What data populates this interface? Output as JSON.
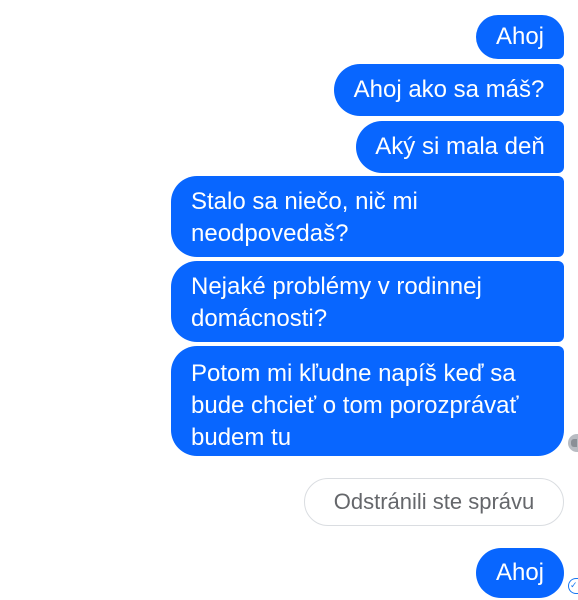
{
  "messages": [
    {
      "text": "Ahoj"
    },
    {
      "text": "Ahoj ako sa máš?"
    },
    {
      "text": "Aký si mala deň"
    },
    {
      "text": "Stalo sa niečo, nič mi neodpovedaš?"
    },
    {
      "text": "Nejaké problémy v rodinnej domácnosti?"
    },
    {
      "text": "Potom mi kľudne napíš keď sa bude chcieť o tom porozprávať budem tu"
    },
    {
      "text": "Ahoj"
    }
  ],
  "removed_message": {
    "text": "Odstránili ste správu"
  },
  "status_icons": {
    "seen": "avatar-seen-icon",
    "delivered": "delivered-check-icon"
  },
  "colors": {
    "bubble": "#0866ff",
    "bubble_text": "#ffffff",
    "removed_border": "#dadde1",
    "removed_text": "#65676b",
    "background": "#ffffff"
  }
}
